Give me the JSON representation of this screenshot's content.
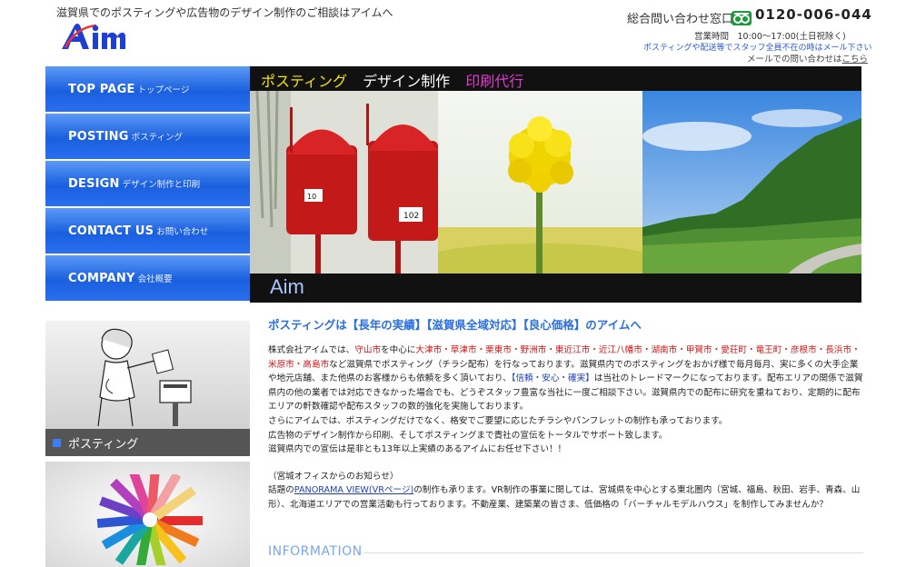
{
  "header": {
    "tagline": "滋賀県でのポスティングや広告物のデザイン制作のご相談はアイムへ",
    "logo_text": "Aim",
    "contact_label": "総合問い合わせ窓口",
    "freedial_icon": "freedial-icon",
    "phone": "0120-006-044",
    "hours": "営業時間　10:00～17:00(土日祝除く)",
    "notice": "ポスティングや配送等でスタッフ全員不在の時はメール下さい",
    "mail_prefix": "メールでの問い合わせは",
    "mail_link": "こちら"
  },
  "nav": {
    "items": [
      {
        "en": "TOP PAGE",
        "jp": "トップページ"
      },
      {
        "en": "POSTING",
        "jp": "ポスティング"
      },
      {
        "en": "DESIGN",
        "jp": "デザイン制作と印刷"
      },
      {
        "en": "CONTACT US",
        "jp": "お問い合わせ"
      },
      {
        "en": "COMPANY",
        "jp": "会社概要"
      }
    ]
  },
  "hero": {
    "categories": [
      "ポスティング",
      "デザイン制作",
      "印刷代行"
    ],
    "category_colors": [
      "#f2e600",
      "#ffffff",
      "#e03ccf"
    ],
    "brand": "Aim",
    "mailbox_numbers": [
      "10",
      "102"
    ]
  },
  "side": {
    "posting_label": "ポスティング"
  },
  "main": {
    "heading": "ポスティングは【長年の実績】【滋賀県全域対応】【良心価格】のアイムへ",
    "p1_a": "株式会社アイムでは、",
    "p1_center": "守山市",
    "p1_b": "を中心に",
    "p1_cities": "大津市・草津市・栗東市・野洲市・東近江市・近江八幡市・湖南市・甲賀市・愛荘町・竜王町・彦根市・長浜市・米原市・高島市",
    "p1_c": "など滋賀県でポスティング（チラシ配布）を行なっております。滋賀県内でのポスティングをおかげ様で毎月毎月、実に多くの大手企業や地元店舗、また他県のお客様からも依頼を多く頂いており、",
    "p1_trust": "【信頼・安心・確実】",
    "p1_d": "は当社のトレードマークになっております。配布エリアの関係で滋賀県内の他の業者では対応できなかった場合でも、どうぞスタッフ豊富な当社に一度ご相談下さい。滋賀県内での配布に研究を重ねており、定期的に配布エリアの軒数確認や配布スタッフの数的強化を実施しております。",
    "p2": "さらにアイムでは、ポスティングだけでなく、格安でご要望に応じたチラシやパンフレットの制作も承っております。",
    "p3": "広告物のデザイン制作から印刷、そしてポスティングまで貴社の宣伝をトータルでサポート致します。",
    "p4": "滋賀県内での宣伝は是非とも13年以上実績のあるアイムにお任せ下さい！！",
    "miyagi_title": "（宮城オフィスからのお知らせ）",
    "miyagi_a": "話題の",
    "miyagi_link": "PANORAMA VIEW(VRページ)",
    "miyagi_b": "の制作も承ります。VR制作の事業に関しては、宮城県を中心とする東北圏内（宮城、福島、秋田、岩手、青森、山形）、北海道エリアでの営業活動も行っております。不動産業、建築業の皆さま、低価格の「バーチャルモデルハウス」を制作してみませんか？"
  },
  "info": {
    "heading": "INFORMATION"
  }
}
